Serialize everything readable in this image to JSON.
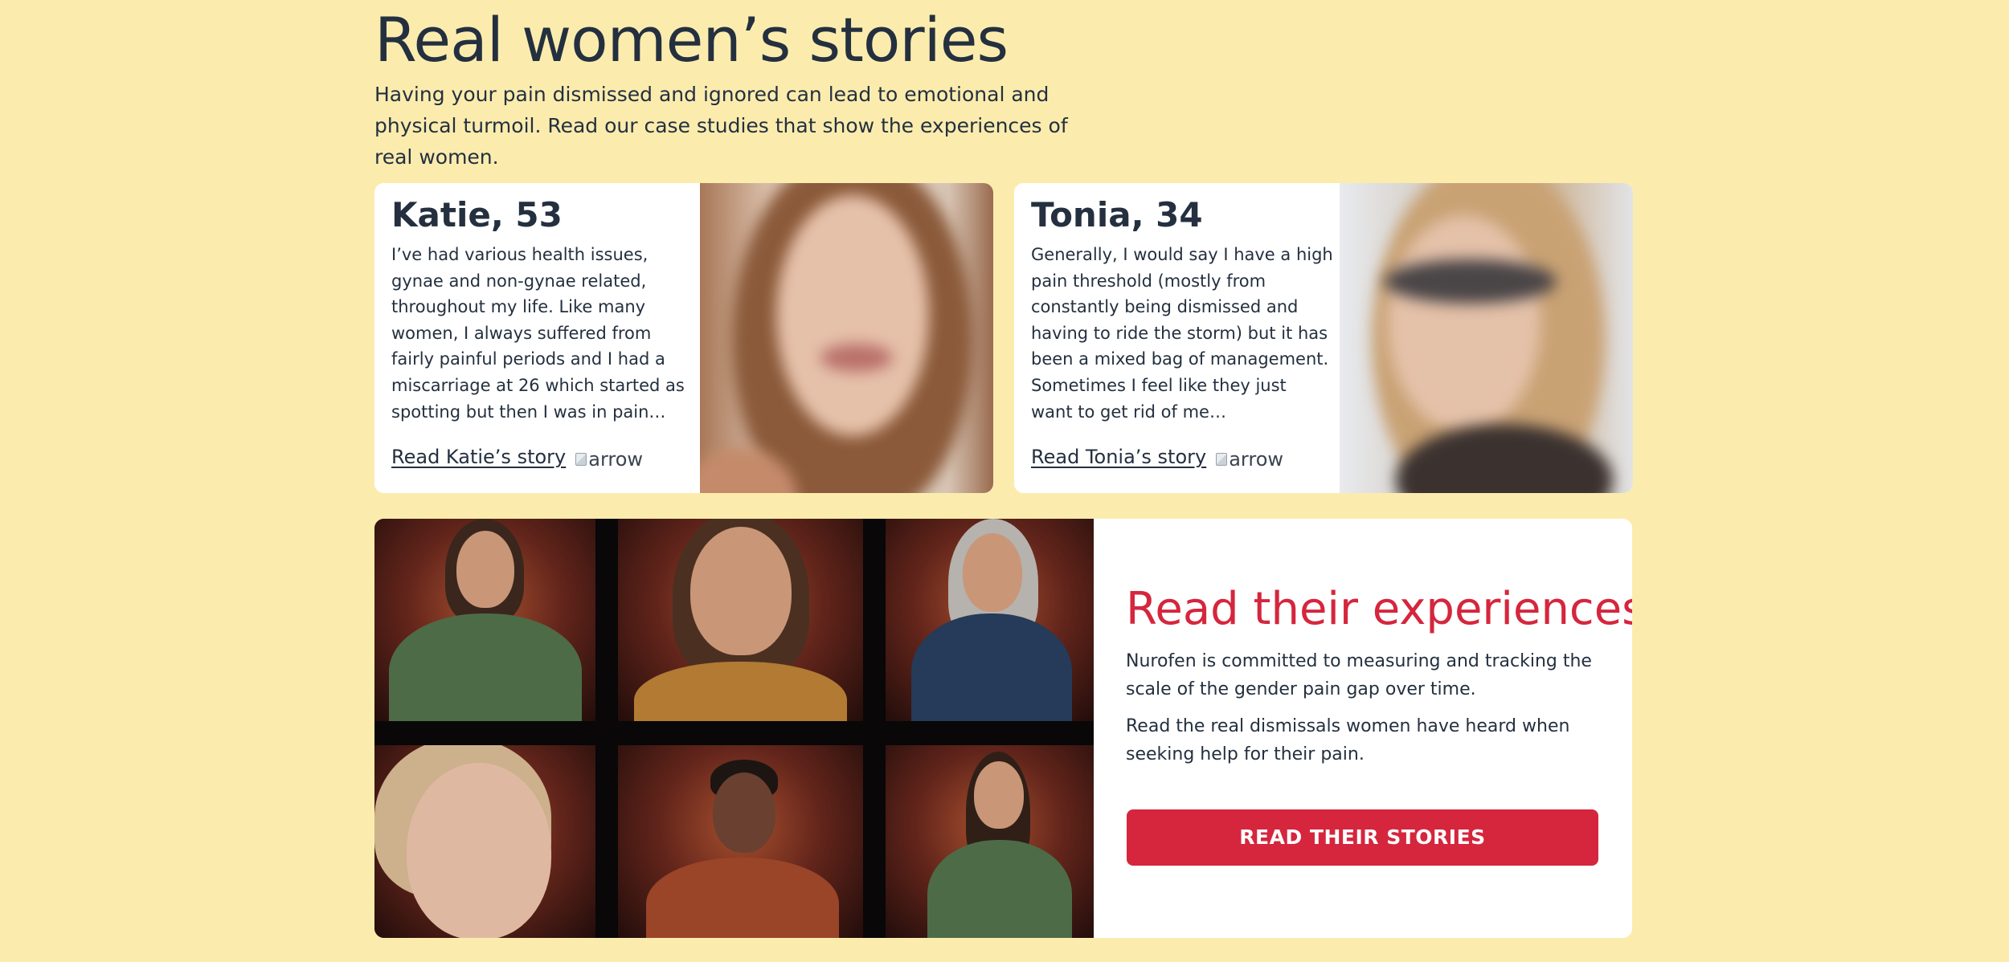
{
  "hero": {
    "title": "Real women’s stories",
    "intro": "Having your pain dismissed and ignored can lead to emotional and physical turmoil. Read our case studies that show the experiences of real women."
  },
  "stories": [
    {
      "name": "Katie, 53",
      "excerpt": "I’ve had various health issues, gynae and non-gynae related, throughout my life. Like many women, I always suffered from fairly painful periods and I had a miscarriage at 26 which started as spotting but then I was in pain…",
      "link_label": "Read Katie’s story",
      "arrow_alt": "arrow",
      "icon": "broken-image-icon"
    },
    {
      "name": "Tonia, 34",
      "excerpt": "Generally, I would say I have a high pain threshold (mostly from constantly being dismissed and having to ride the storm) but it has been a mixed bag of management. Sometimes I feel like they just want to get rid of me…",
      "link_label": "Read Tonia’s story",
      "arrow_alt": "arrow",
      "icon": "broken-image-icon"
    }
  ],
  "experiences": {
    "title": "Read their experiences",
    "paragraph_1": "Nurofen is committed to measuring and tracking the scale of the gender pain gap over time.",
    "paragraph_2": "Read the real dismissals women have heard when seeking help for their pain.",
    "button_label": "READ THEIR STORIES"
  },
  "colors": {
    "page_background": "#fbecae",
    "text": "#24303f",
    "accent_red": "#d5263d",
    "card_background": "#ffffff"
  }
}
